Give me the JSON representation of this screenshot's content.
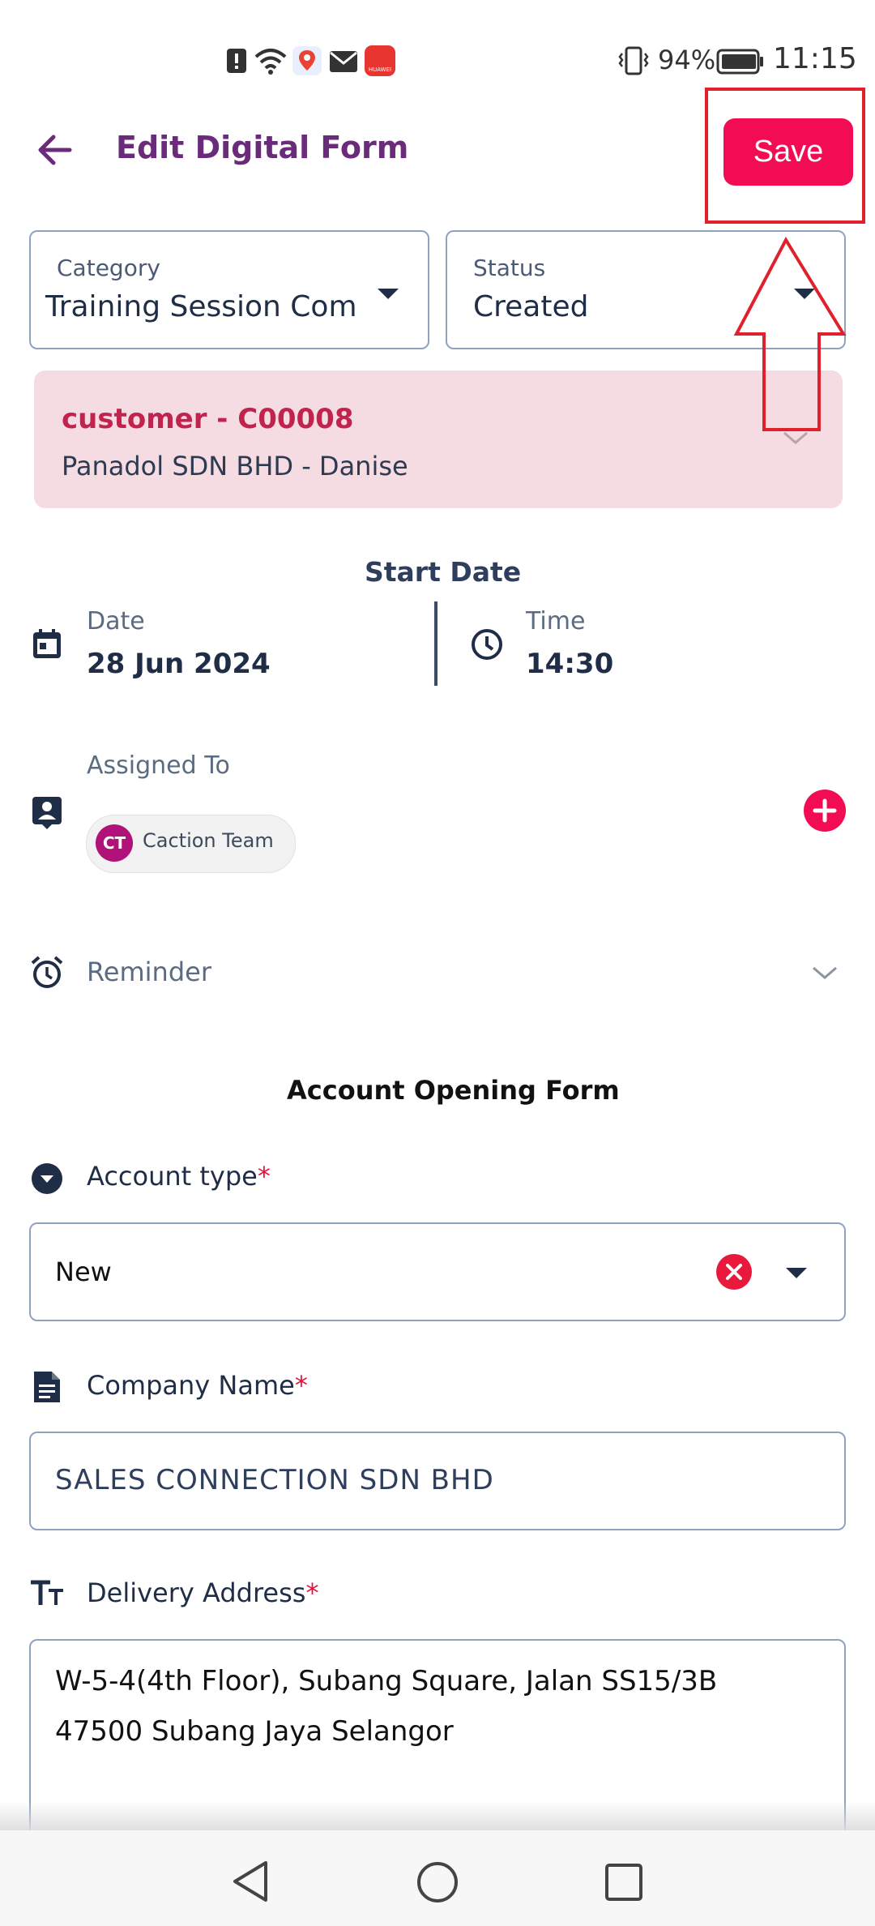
{
  "status_bar": {
    "battery": "94%",
    "time": "11:15",
    "app_badge": "HUAWEI"
  },
  "header": {
    "title": "Edit Digital Form",
    "save_label": "Save",
    "accent_color": "#f20c53",
    "highlight_color": "#e0212c"
  },
  "category": {
    "label": "Category",
    "value": "Training Session Com"
  },
  "status": {
    "label": "Status",
    "value": "Created"
  },
  "customer": {
    "title": "customer  -  C00008",
    "subtitle": "Panadol SDN BHD - Danise",
    "card_color": "#f5dbe2"
  },
  "start_date": {
    "heading": "Start Date",
    "date_label": "Date",
    "date_value": "28 Jun 2024",
    "time_label": "Time",
    "time_value": "14:30"
  },
  "assigned": {
    "label": "Assigned To",
    "chip_initials": "CT",
    "chip_name": "Caction Team"
  },
  "reminder": {
    "label": "Reminder"
  },
  "form": {
    "title": "Account Opening Form",
    "account_type": {
      "label": "Account type",
      "required": "*",
      "value": "New"
    },
    "company_name": {
      "label": "Company Name",
      "required": "*",
      "value": "SALES CONNECTION SDN BHD"
    },
    "delivery_address": {
      "label": "Delivery Address",
      "required": "*",
      "line1": "W-5-4(4th Floor), Subang Square, Jalan SS15/3B",
      "line2": "47500 Subang Jaya Selangor"
    }
  },
  "icons": {
    "back": "arrow-left-icon",
    "calendar": "calendar-icon",
    "clock": "clock-icon",
    "contact": "contact-card-icon",
    "alarm": "alarm-icon",
    "dropdown_circle": "chevron-circle-icon",
    "document": "document-icon",
    "text": "text-format-icon"
  }
}
